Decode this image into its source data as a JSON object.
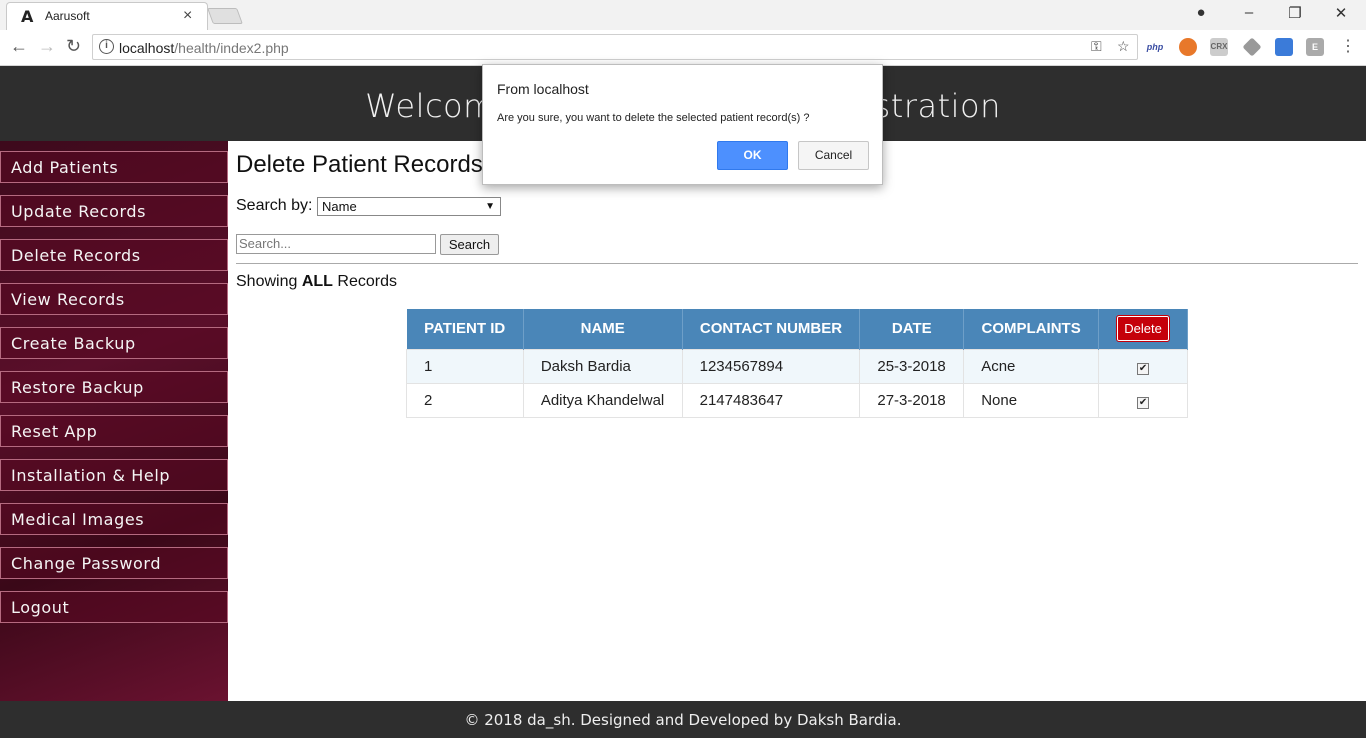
{
  "browser": {
    "tab_title": "Aarusoft",
    "tab_logo": "A",
    "url_host": "localhost",
    "url_path": "/health/index2.php",
    "extensions": [
      "php",
      "CRX",
      "E"
    ]
  },
  "header": {
    "title": "Welcome to the Patient Administration"
  },
  "sidebar": {
    "items": [
      {
        "label": "Add Patients"
      },
      {
        "label": "Update Records"
      },
      {
        "label": "Delete Records"
      },
      {
        "label": "View Records"
      },
      {
        "label": "Create Backup"
      },
      {
        "label": "Restore Backup"
      },
      {
        "label": "Reset App"
      },
      {
        "label": "Installation & Help"
      },
      {
        "label": "Medical Images"
      },
      {
        "label": "Change Password"
      },
      {
        "label": "Logout"
      }
    ]
  },
  "main": {
    "title": "Delete Patient Records",
    "search_by_label": "Search by:",
    "search_by_value": "Name",
    "search_placeholder": "Search...",
    "search_button": "Search",
    "showing_prefix": "Showing",
    "showing_bold": "ALL",
    "showing_suffix": "Records"
  },
  "table": {
    "columns": [
      "PATIENT ID",
      "NAME",
      "CONTACT NUMBER",
      "DATE",
      "COMPLAINTS"
    ],
    "delete_label": "Delete",
    "rows": [
      {
        "id": "1",
        "name": "Daksh Bardia",
        "contact": "1234567894",
        "date": "25-3-2018",
        "complaints": "Acne",
        "checked": true
      },
      {
        "id": "2",
        "name": "Aditya Khandelwal",
        "contact": "2147483647",
        "date": "27-3-2018",
        "complaints": "None",
        "checked": true
      }
    ]
  },
  "footer": {
    "text": "© 2018 da_sh. Designed and Developed by Daksh Bardia."
  },
  "dialog": {
    "title": "From localhost",
    "message": "Are you sure, you want to delete the selected patient record(s) ?",
    "ok": "OK",
    "cancel": "Cancel"
  },
  "colors": {
    "header_bg": "#2e2e2e",
    "sidebar_bg": "#4a0c22",
    "table_header": "#4a86b8",
    "delete_red": "#c5000a",
    "ok_blue": "#4d90fe"
  }
}
